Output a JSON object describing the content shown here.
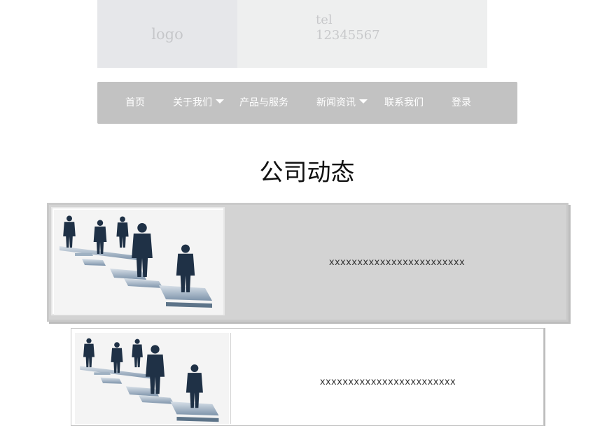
{
  "header": {
    "logo_text": "logo",
    "tel_label": "tel",
    "tel_number": "12345567"
  },
  "nav": {
    "items": [
      {
        "label": "首页",
        "dropdown": false
      },
      {
        "label": "关于我们",
        "dropdown": true
      },
      {
        "label": "产品与服务",
        "dropdown": false
      },
      {
        "label": "新闻资讯",
        "dropdown": true
      },
      {
        "label": "联系我们",
        "dropdown": false
      },
      {
        "label": "登录",
        "dropdown": false
      }
    ]
  },
  "section": {
    "title": "公司动态"
  },
  "news": [
    {
      "text": "xxxxxxxxxxxxxxxxxxxxxxxx",
      "image": "business-people-puzzle-image"
    },
    {
      "text": "xxxxxxxxxxxxxxxxxxxxxxxx",
      "image": "business-people-puzzle-image"
    }
  ],
  "colors": {
    "nav_background": "#c2c2c2",
    "logo_background": "#e6e7ea",
    "tel_background": "#eeefef",
    "card_background": "#d3d3d3"
  }
}
